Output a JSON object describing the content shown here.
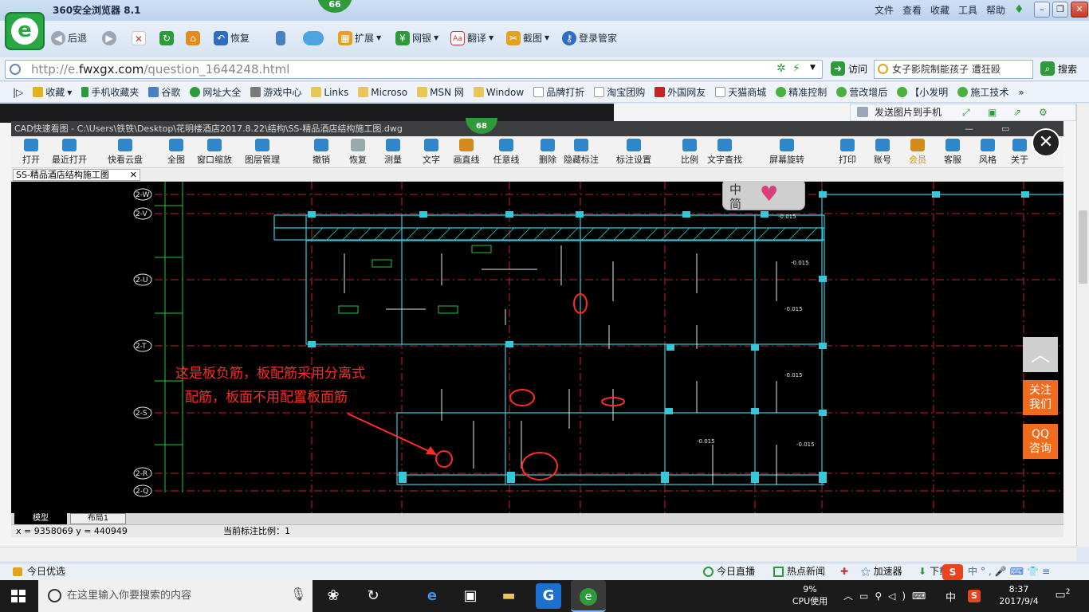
{
  "browser": {
    "title": "360安全浏览器 8.1",
    "badge": "66",
    "menu": [
      "文件",
      "查看",
      "收藏",
      "工具",
      "帮助"
    ],
    "toolbar": [
      {
        "label": "后退",
        "icon": "back-icon"
      },
      {
        "label": "",
        "icon": "forward-icon"
      },
      {
        "label": "",
        "icon": "stop-icon"
      },
      {
        "label": "",
        "icon": "refresh-icon"
      },
      {
        "label": "",
        "icon": "home-icon"
      },
      {
        "label": "恢复",
        "icon": "undo-icon"
      },
      {
        "label": "",
        "icon": "phone-icon"
      },
      {
        "label": "",
        "icon": "cloud-icon"
      },
      {
        "label": "扩展",
        "icon": "extension-icon"
      },
      {
        "label": "网银",
        "icon": "shield-icon"
      },
      {
        "label": "翻译",
        "icon": "translate-icon"
      },
      {
        "label": "截图",
        "icon": "screenshot-icon"
      },
      {
        "label": "登录管家",
        "icon": "key-icon"
      }
    ],
    "address": {
      "prefix": "http://e.",
      "domain": "fwxgx.com",
      "path": "/question_1644248.html"
    },
    "visit_label": "访问",
    "search_text": "女子影院制能孩子 遭狂殴",
    "search_label": "搜索",
    "bookmarks": [
      "收藏",
      "手机收藏夹",
      "谷歌",
      "网址大全",
      "游戏中心",
      "Links",
      "Microso",
      "MSN 网",
      "Window",
      "品牌打折",
      "淘宝团购",
      "外国网友",
      "天猫商城",
      "精准控制",
      "营改增后",
      "【小发明",
      "施工技术"
    ],
    "send_to_phone": "发送图片到手机"
  },
  "cad": {
    "title": "CAD快速看图 - C:\\Users\\铁铁\\Desktop\\花明楼酒店2017.8.22\\结构\\SS-精品酒店结构施工图.dwg",
    "badge": "68",
    "tools": [
      "打开",
      "最近打开",
      "快看云盘",
      "全图",
      "窗口缩放",
      "图层管理",
      "撤销",
      "恢复",
      "测量",
      "文字",
      "画直线",
      "任意线",
      "删除",
      "隐藏标注",
      "标注设置",
      "比例",
      "文字查找",
      "屏幕旋转",
      "打印",
      "账号",
      "会员",
      "客服",
      "风格",
      "关于"
    ],
    "doc_tab": "SS-精品酒店结构施工图",
    "ime": {
      "line1": "中",
      "line2": "简"
    },
    "annotation": {
      "line1": "这是板负筋，板配筋采用分离式",
      "line2": "配筋，板面不用配置板面筋"
    },
    "grid_labels": [
      "2-W",
      "2-V",
      "2-U",
      "2-T",
      "2-S",
      "2-R",
      "2-Q"
    ],
    "levels": [
      "-0.015",
      "-0.015",
      "-0.015",
      "-0.015",
      "-0.015",
      "-0.015",
      "-0.015"
    ],
    "layout_tabs": [
      "模型",
      "布局1"
    ],
    "coords": "x = 9358069  y = 440949",
    "scale_text": "当前标注比例：1"
  },
  "side_float": {
    "to_top": "",
    "follow": [
      "关注",
      "我们"
    ],
    "qq": [
      "QQ",
      "咨询"
    ]
  },
  "status": {
    "left": "今日优选",
    "items": [
      "今日直播",
      "热点新闻",
      "",
      "加速器",
      "下载"
    ]
  },
  "taskbar": {
    "search_placeholder": "在这里输入你要搜索的内容",
    "cpu_percent": "9%",
    "cpu_label": "CPU使用",
    "ime": "中",
    "time": "8:37",
    "date": "2017/9/4",
    "notif_count": "2"
  }
}
